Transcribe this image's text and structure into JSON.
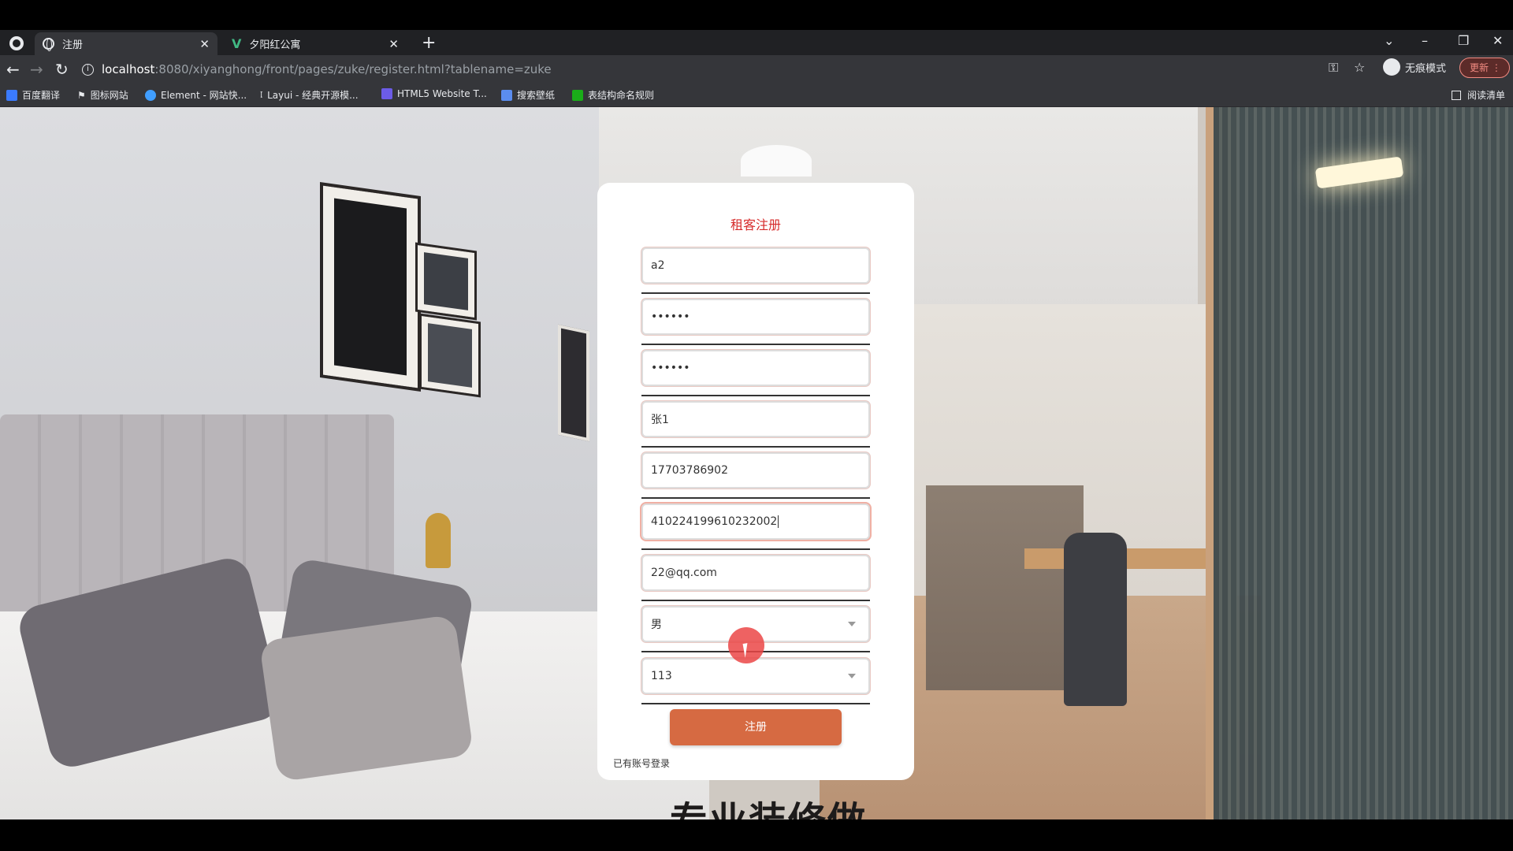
{
  "browser": {
    "tabs": [
      {
        "title": "注册",
        "active": true
      },
      {
        "title": "夕阳红公寓",
        "active": false
      }
    ],
    "url_host": "localhost",
    "url_rest": ":8080/xiyanghong/front/pages/zuke/register.html?tablename=zuke",
    "incognito_label": "无痕模式",
    "update_label": "更新",
    "bookmarks": [
      {
        "label": "百度翻译",
        "color": "#3b7bff"
      },
      {
        "label": "图标网站",
        "color": "#e8eaed"
      },
      {
        "label": "Element - 网站快...",
        "color": "#409eff"
      },
      {
        "label": "Layui - 经典开源模...",
        "color": "#e8eaed"
      },
      {
        "label": "HTML5 Website T...",
        "color": "#6c5ce7"
      },
      {
        "label": "搜索壁纸",
        "color": "#5b8def"
      },
      {
        "label": "表结构命名规则",
        "color": "#1aad19"
      }
    ],
    "reading_list_label": "阅读清单"
  },
  "form": {
    "title": "租客注册",
    "fields": [
      {
        "name": "username",
        "value": "a2"
      },
      {
        "name": "password",
        "value": "••••••"
      },
      {
        "name": "confirm-password",
        "value": "••••••"
      },
      {
        "name": "name",
        "value": "张1"
      },
      {
        "name": "phone",
        "value": "17703786902"
      },
      {
        "name": "id-card",
        "value": "410224199610232002"
      },
      {
        "name": "email",
        "value": "22@qq.com"
      }
    ],
    "gender_selected": "男",
    "room_selected": "113",
    "submit_label": "注册",
    "login_link": "已有账号登录"
  },
  "page_overlay_text": "专业装修做",
  "colors": {
    "accent": "#d66a42",
    "title_red": "#d62a2a"
  }
}
